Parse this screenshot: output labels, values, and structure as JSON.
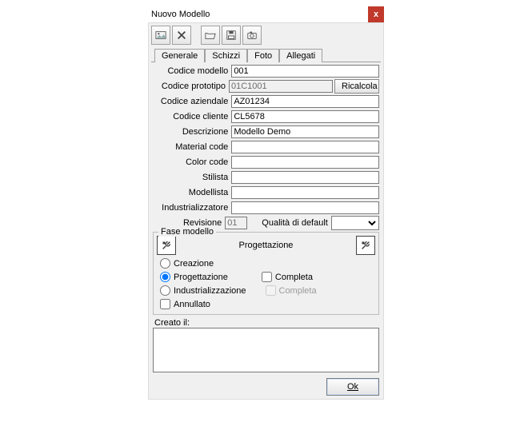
{
  "window": {
    "title": "Nuovo Modello",
    "close": "x"
  },
  "tabs": {
    "t0": "Generale",
    "t1": "Schizzi",
    "t2": "Foto",
    "t3": "Allegati"
  },
  "labels": {
    "codice_modello": "Codice modello",
    "codice_prototipo": "Codice prototipo",
    "codice_aziendale": "Codice aziendale",
    "codice_cliente": "Codice cliente",
    "descrizione": "Descrizione",
    "material_code": "Material code",
    "color_code": "Color code",
    "stilista": "Stilista",
    "modellista": "Modellista",
    "industrializzatore": "Industrializzatore",
    "revisione": "Revisione",
    "qualita": "Qualità di default",
    "fase_modello": "Fase modello",
    "fase_title": "Progettazione",
    "creazione": "Creazione",
    "progettazione": "Progettazione",
    "industrializzazione": "Industrializzazione",
    "completa": "Completa",
    "completa2": "Completa",
    "annullato": "Annullato",
    "creato_il": "Creato il:"
  },
  "values": {
    "codice_modello": "001",
    "codice_prototipo": "01C1001",
    "codice_aziendale": "AZ01234",
    "codice_cliente": "CL5678",
    "descrizione": "Modello Demo",
    "material_code": "",
    "color_code": "",
    "stilista": "",
    "modellista": "",
    "industrializzatore": "",
    "revisione": "01",
    "qualita": "",
    "notes": ""
  },
  "buttons": {
    "ricalcola": "Ricalcola",
    "ok": "Ok"
  }
}
